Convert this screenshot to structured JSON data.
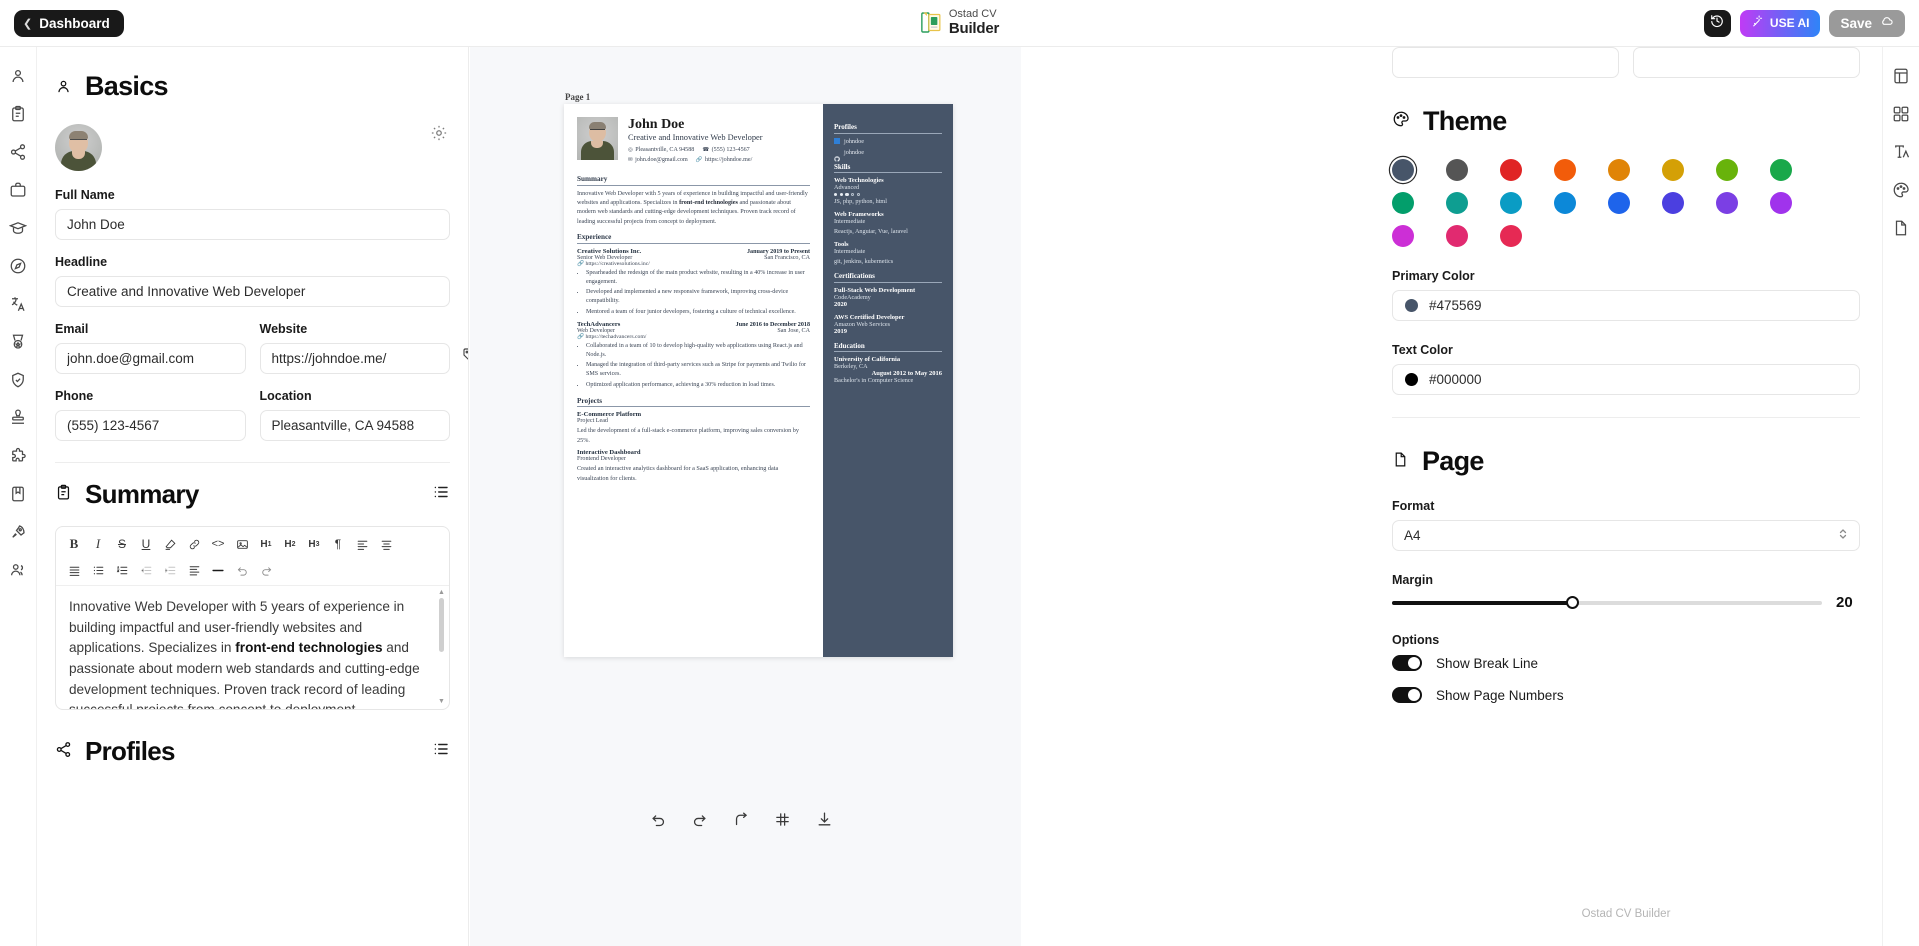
{
  "topbar": {
    "dashboard_label": "Dashboard",
    "back_icon": "chevron-left-icon",
    "brand_line1": "Ostad CV",
    "brand_line2": "Builder",
    "history_icon": "history-clock-icon",
    "ai_label": "USE AI",
    "ai_icon": "magic-wand-icon",
    "save_label": "Save",
    "save_icon": "cloud-icon"
  },
  "left_rail": {
    "items": [
      {
        "icon": "user-icon",
        "name": "basics"
      },
      {
        "icon": "clipboard-icon",
        "name": "summary"
      },
      {
        "icon": "share-nodes-icon",
        "name": "profiles"
      },
      {
        "icon": "briefcase-icon",
        "name": "experience"
      },
      {
        "icon": "graduation-cap-icon",
        "name": "education"
      },
      {
        "icon": "compass-icon",
        "name": "interests"
      },
      {
        "icon": "translate-icon",
        "name": "languages"
      },
      {
        "icon": "medal-icon",
        "name": "awards"
      },
      {
        "icon": "shield-check-icon",
        "name": "certifications"
      },
      {
        "icon": "stamp-icon",
        "name": "references"
      },
      {
        "icon": "puzzle-icon",
        "name": "skills"
      },
      {
        "icon": "book-icon",
        "name": "publications"
      },
      {
        "icon": "rocket-icon",
        "name": "projects"
      },
      {
        "icon": "users-icon",
        "name": "volunteering"
      }
    ]
  },
  "right_rail": {
    "items": [
      {
        "icon": "layout-template-icon",
        "name": "template"
      },
      {
        "icon": "layout-grid-icon",
        "name": "layout"
      },
      {
        "icon": "typography-icon",
        "name": "typography"
      },
      {
        "icon": "palette-icon",
        "name": "theme"
      },
      {
        "icon": "page-icon",
        "name": "page"
      }
    ]
  },
  "basics": {
    "heading": "Basics",
    "heading_icon": "user-icon",
    "avatar_name": "profile-avatar",
    "gear_icon": "settings-gear-icon",
    "fields": {
      "full_name_label": "Full Name",
      "full_name_value": "John Doe",
      "headline_label": "Headline",
      "headline_value": "Creative and Innovative Web Developer",
      "email_label": "Email",
      "email_value": "john.doe@gmail.com",
      "website_label": "Website",
      "website_value": "https://johndoe.me/",
      "website_tag_icon": "tag-icon",
      "phone_label": "Phone",
      "phone_value": "(555) 123-4567",
      "location_label": "Location",
      "location_value": "Pleasantville, CA 94588"
    }
  },
  "summary": {
    "heading": "Summary",
    "heading_icon": "clipboard-icon",
    "list_icon": "list-icon",
    "toolbar_row1": [
      {
        "name": "bold-icon",
        "label": "B"
      },
      {
        "name": "italic-icon",
        "label": "I"
      },
      {
        "name": "strikethrough-icon",
        "label": "S"
      },
      {
        "name": "underline-icon",
        "label": "U"
      },
      {
        "name": "highlight-icon",
        "label": ""
      },
      {
        "name": "link-icon",
        "label": ""
      },
      {
        "name": "code-icon",
        "label": "<>"
      },
      {
        "name": "image-icon",
        "label": ""
      },
      {
        "name": "heading-1-icon",
        "label": "H1"
      },
      {
        "name": "heading-2-icon",
        "label": "H2"
      },
      {
        "name": "heading-3-icon",
        "label": "H3"
      },
      {
        "name": "paragraph-icon",
        "label": "¶"
      },
      {
        "name": "align-left-icon",
        "label": ""
      },
      {
        "name": "align-center-icon",
        "label": ""
      }
    ],
    "toolbar_row2": [
      {
        "name": "align-justify-icon",
        "label": ""
      },
      {
        "name": "bullet-list-icon",
        "label": ""
      },
      {
        "name": "ordered-list-icon",
        "label": ""
      },
      {
        "name": "outdent-icon",
        "label": ""
      },
      {
        "name": "indent-icon",
        "label": ""
      },
      {
        "name": "line-height-icon",
        "label": ""
      },
      {
        "name": "horizontal-rule-icon",
        "label": ""
      },
      {
        "name": "undo-icon",
        "label": ""
      },
      {
        "name": "redo-icon",
        "label": ""
      }
    ],
    "text_part1": "Innovative Web Developer with 5 years of experience in building impactful and user-friendly websites and applications. Specializes in ",
    "text_bold": "front-end technologies",
    "text_part2": " and passionate about modern web standards and cutting-edge development techniques. Proven track record of leading successful projects from concept to deployment."
  },
  "profiles_section": {
    "heading": "Profiles",
    "heading_icon": "share-nodes-icon",
    "list_icon": "list-icon"
  },
  "preview": {
    "page_label": "Page 1",
    "resume": {
      "name": "John Doe",
      "title": "Creative and Innovative Web Developer",
      "contact": {
        "location": "Pleasantville, CA 94588",
        "phone": "(555) 123-4567",
        "email": "john.doe@gmail.com",
        "website": "https://johndoe.me/"
      },
      "summary_heading": "Summary",
      "summary_part1": "Innovative Web Developer with 5 years of experience in building impactful and user-friendly websites and applications. Specializes in ",
      "summary_bold": "front-end technologies",
      "summary_part2": " and passionate about modern web standards and cutting-edge development techniques. Proven track record of leading successful projects from concept to deployment.",
      "experience_heading": "Experience",
      "experience": [
        {
          "org": "Creative Solutions Inc.",
          "date": "January 2019 to Present",
          "role": "Senior Web Developer",
          "location": "San Francisco, CA",
          "link": "https://creativesolutions.inc/",
          "bullets": [
            "Spearheaded the redesign of the main product website, resulting in a 40% increase in user engagement.",
            "Developed and implemented a new responsive framework, improving cross-device compatibility.",
            "Mentored a team of four junior developers, fostering a culture of technical excellence."
          ]
        },
        {
          "org": "TechAdvancers",
          "date": "June 2016 to December 2018",
          "role": "Web Developer",
          "location": "San Jose, CA",
          "link": "https://techadvancers.com/",
          "bullets": [
            "Collaborated in a team of 10 to develop high-quality web applications using React.js and Node.js.",
            "Managed the integration of third-party services such as Stripe for payments and Twilio for SMS services.",
            "Optimized application performance, achieving a 30% reduction in load times."
          ]
        }
      ],
      "projects_heading": "Projects",
      "projects": [
        {
          "name": "E-Commerce Platform",
          "role": "Project Lead",
          "desc": "Led the development of a full-stack e-commerce platform, improving sales conversion by 25%."
        },
        {
          "name": "Interactive Dashboard",
          "role": "Frontend Developer",
          "desc": "Created an interactive analytics dashboard for a SaaS application, enhancing data visualization for clients."
        }
      ],
      "sidebar": {
        "profiles_heading": "Profiles",
        "profiles": [
          {
            "network": "linkedin-icon",
            "username": "johndoe"
          },
          {
            "network": "github-icon",
            "username": "johndoe"
          }
        ],
        "skills_heading": "Skills",
        "skills": [
          {
            "name": "Web Technologies",
            "level_label": "Advanced",
            "level": 3,
            "max": 5,
            "keywords": "JS, php, python, html"
          },
          {
            "name": "Web Frameworks",
            "level_label": "Intermediate",
            "level": 0,
            "max": 5,
            "keywords": "Reactjs, Anguiar, Vue, laravel"
          },
          {
            "name": "Tools",
            "level_label": "Intermediate",
            "level": 0,
            "max": 5,
            "keywords": "git, jenkins, kubernetics"
          }
        ],
        "certifications_heading": "Certifications",
        "certifications": [
          {
            "name": "Full-Stack Web Development",
            "issuer": "CodeAcademy",
            "year": "2020"
          },
          {
            "name": "AWS Certified Developer",
            "issuer": "Amazon Web Services",
            "year": "2019"
          }
        ],
        "education_heading": "Education",
        "education": [
          {
            "school": "University of California",
            "location": "Berkeley, CA",
            "date": "August 2012 to May 2016",
            "degree": "Bachelor's in Computer Science"
          }
        ]
      }
    },
    "bottom_tools": [
      {
        "name": "undo-icon"
      },
      {
        "name": "redo-icon"
      },
      {
        "name": "reset-view-icon"
      },
      {
        "name": "center-artboard-icon"
      },
      {
        "name": "download-icon"
      }
    ]
  },
  "settings": {
    "theme": {
      "heading": "Theme",
      "heading_icon": "palette-icon",
      "swatches": [
        "#475569",
        "#555555",
        "#e02424",
        "#f25c0a",
        "#e08407",
        "#d4a006",
        "#68b30b",
        "#19a84a",
        "#039e6b",
        "#0e9e91",
        "#0a9cc4",
        "#0c88d8",
        "#1e64eb",
        "#4b3fe0",
        "#7b3fe4",
        "#a033ec",
        "#cc2fd6",
        "#e12a70",
        "#e62954"
      ],
      "selected_index": 0,
      "primary_color_label": "Primary Color",
      "primary_color_value": "#475569",
      "text_color_label": "Text Color",
      "text_color_value": "#000000"
    },
    "page": {
      "heading": "Page",
      "heading_icon": "page-icon",
      "format_label": "Format",
      "format_value": "A4",
      "margin_label": "Margin",
      "margin_value": "20",
      "margin_percent": 42,
      "options_label": "Options",
      "toggles": [
        {
          "label": "Show Break Line",
          "on": true
        },
        {
          "label": "Show Page Numbers",
          "on": true
        }
      ]
    },
    "footer": "Ostad CV Builder"
  }
}
